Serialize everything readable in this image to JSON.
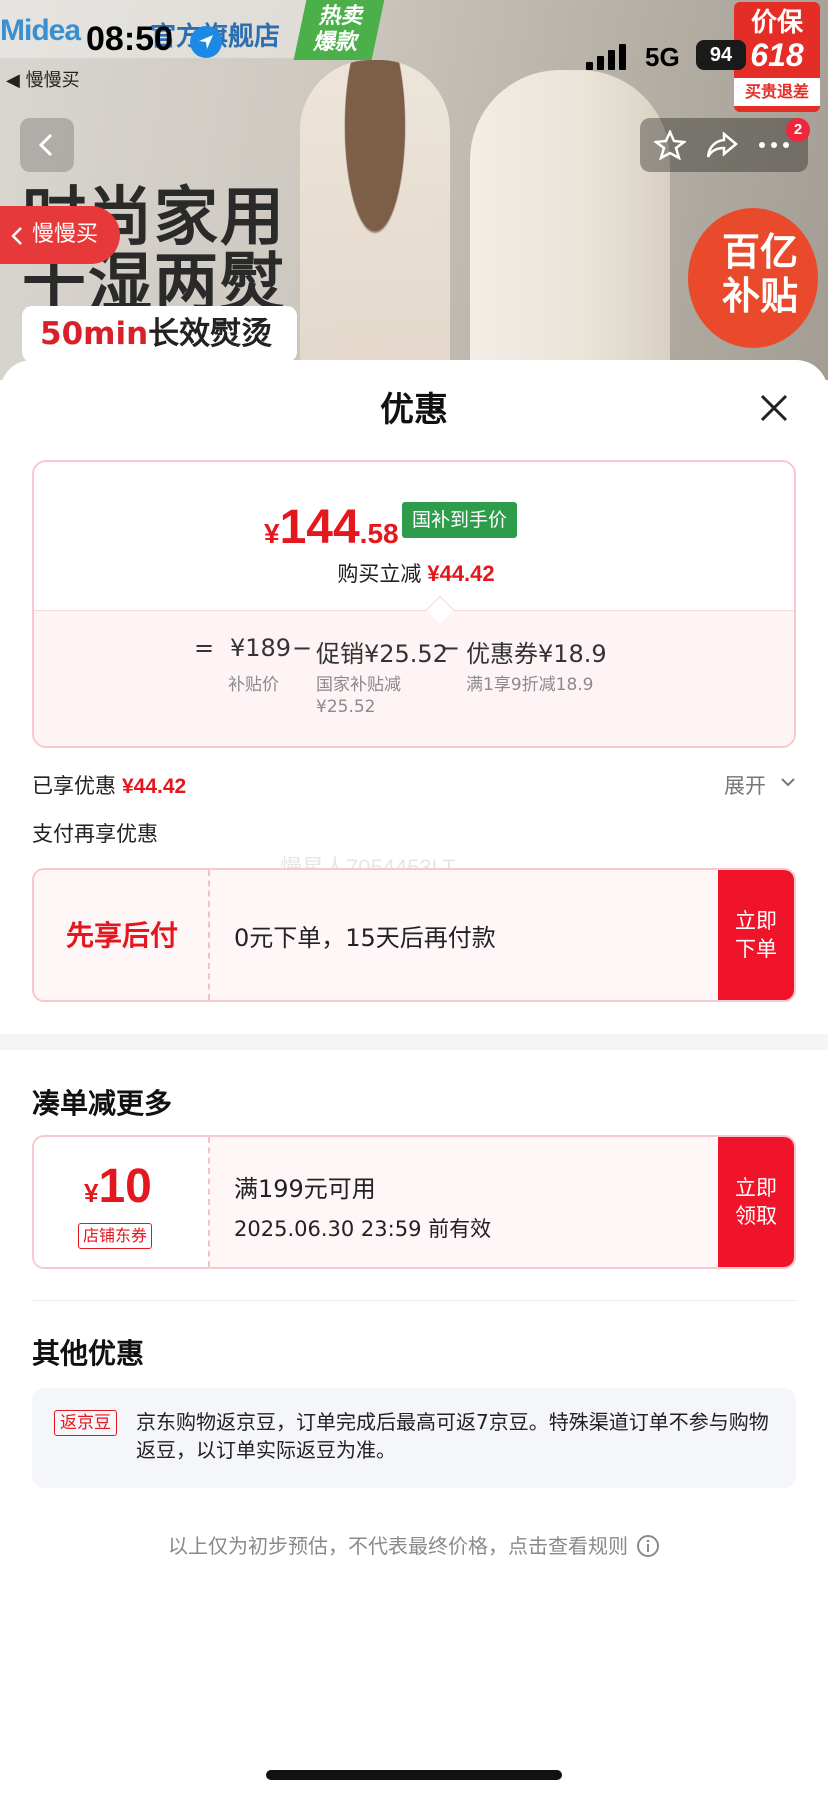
{
  "status_bar": {
    "time": "08:50",
    "network": "5G",
    "battery": "94"
  },
  "banner": {
    "brand": "Midea",
    "store": "官方旗舰店",
    "hot_tag": "热卖爆款",
    "promo_line1": "价保",
    "promo_line2": "618",
    "promo_line3": "买贵退差",
    "back_app": "◀ 慢慢买",
    "slogan_line1": "时尚家用",
    "slogan_line2": "干湿两熨",
    "slogan_pill_highlight": "50min",
    "slogan_pill_rest": "长效熨烫",
    "subsidy_badge": "百亿补贴",
    "slow_buy_button": "慢慢买",
    "cart_badge": "2"
  },
  "sheet": {
    "title": "优惠",
    "price": {
      "currency": "¥",
      "integer": "144",
      "decimal": ".58",
      "tag": "国补到手价"
    },
    "instant_cut_label": "购买立减",
    "instant_cut_amount": "¥44.42",
    "formula": {
      "equals": "=",
      "base_value": "¥189",
      "base_label": "补贴价",
      "minus1": "−",
      "promo_value": "促销¥25.52",
      "promo_label": "国家补贴减\n¥25.52",
      "minus2": "−",
      "coupon_value": "优惠券¥18.9",
      "coupon_label": "满1享9折减18.9"
    },
    "enjoyed_label": "已享优惠",
    "enjoyed_amount": "¥44.42",
    "expand_label": "展开",
    "pay_section_title": "支付再享优惠",
    "watermark": "慢星人7054453LT",
    "pay_card": {
      "name": "先享后付",
      "desc": "0元下单，15天后再付款",
      "button": "立即下单"
    },
    "more_section_title": "凑单减更多",
    "coupon": {
      "currency": "¥",
      "value": "10",
      "tag": "店铺东券",
      "condition": "满199元可用",
      "expiry": "2025.06.30 23:59 前有效",
      "button": "立即领取"
    },
    "other_section_title": "其他优惠",
    "bean": {
      "tag": "返京豆",
      "text": "京东购物返京豆，订单完成后最高可返7京豆。特殊渠道订单不参与购物返豆，以订单实际返豆为准。"
    },
    "disclaimer": "以上仅为初步预估，不代表最终价格，点击查看规则"
  },
  "colors": {
    "accent_red": "#e4161e",
    "button_red": "#f0142a",
    "gov_green": "#2e9c4a"
  }
}
